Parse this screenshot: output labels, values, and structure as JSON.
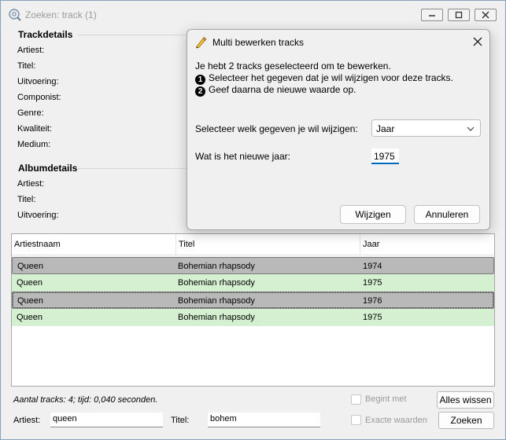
{
  "window": {
    "title": "Zoeken: track (1)"
  },
  "trackdetails": {
    "heading": "Trackdetails",
    "fields": [
      "Artiest:",
      "Titel:",
      "Uitvoering:",
      "Componist:",
      "Genre:",
      "Kwaliteit:",
      "Medium:"
    ]
  },
  "albumdetails": {
    "heading": "Albumdetails",
    "fields": [
      "Artiest:",
      "Titel:",
      "Uitvoering:"
    ]
  },
  "grid": {
    "columns": [
      "Artiestnaam",
      "Titel",
      "Jaar"
    ],
    "rows": [
      {
        "artist": "Queen",
        "title": "Bohemian rhapsody",
        "year": "1974"
      },
      {
        "artist": "Queen",
        "title": "Bohemian rhapsody",
        "year": "1975"
      },
      {
        "artist": "Queen",
        "title": "Bohemian rhapsody",
        "year": "1976"
      },
      {
        "artist": "Queen",
        "title": "Bohemian rhapsody",
        "year": "1975"
      }
    ]
  },
  "status": "Aantal tracks: 4; tijd: 0,040 seconden.",
  "search": {
    "artist_label": "Artiest:",
    "artist_value": "queen",
    "title_label": "Titel:",
    "title_value": "bohem",
    "begint_met": "Begint met",
    "exacte_waarden": "Exacte waarden",
    "clear_button": "Alles wissen",
    "search_button": "Zoeken"
  },
  "dialog": {
    "title": "Multi bewerken tracks",
    "intro": "Je hebt 2 tracks geselecteerd om te bewerken.",
    "step1_num": "1",
    "step1": "Selecteer het gegeven dat je wil wijzigen voor deze tracks.",
    "step2_num": "2",
    "step2": "Geef daarna de nieuwe waarde op.",
    "select_label": "Selecteer welk gegeven je wil wijzigen:",
    "select_value": "Jaar",
    "new_value_label": "Wat is het nieuwe jaar:",
    "new_value": "1975",
    "ok_button": "Wijzigen",
    "cancel_button": "Annuleren"
  },
  "colors": {
    "selected_row": "#b9b9b9",
    "changed_row": "#d5f0d0",
    "focus_underline": "#0067c0"
  }
}
